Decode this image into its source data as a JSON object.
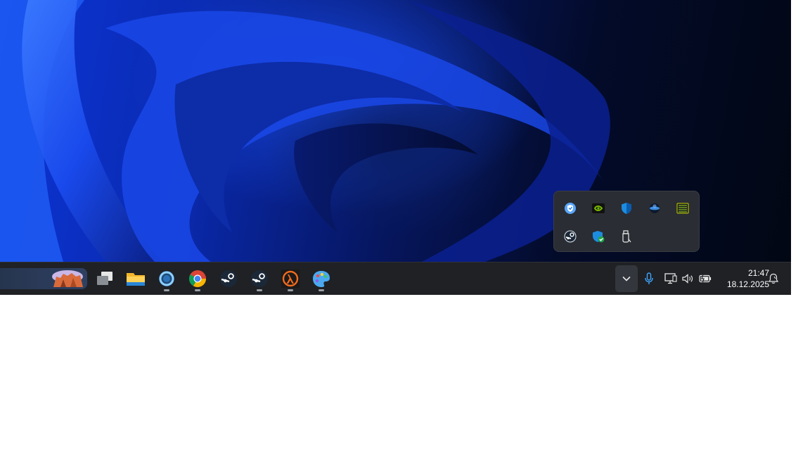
{
  "desktop": {
    "wallpaper": "windows-11-bloom-blue"
  },
  "tray_overflow": {
    "icons": [
      {
        "name": "vpn-shield-icon"
      },
      {
        "name": "nvidia-icon"
      },
      {
        "name": "defender-shield-icon"
      },
      {
        "name": "steelseries-orb-icon"
      },
      {
        "name": "hardware-monitor-icon"
      },
      {
        "name": "steam-icon"
      },
      {
        "name": "security-check-icon"
      },
      {
        "name": "usb-drive-icon"
      }
    ]
  },
  "taskbar": {
    "apps": [
      {
        "name": "task-view-icon",
        "running": false
      },
      {
        "name": "file-explorer-icon",
        "running": false
      },
      {
        "name": "app-ring-icon",
        "running": true
      },
      {
        "name": "chrome-icon",
        "running": true
      },
      {
        "name": "steam-icon",
        "running": false
      },
      {
        "name": "steam-icon",
        "running": true
      },
      {
        "name": "half-life-icon",
        "running": true
      },
      {
        "name": "paint-icon",
        "running": true
      }
    ],
    "system_tray": {
      "chevron": "chevron-up-icon",
      "mic": "microphone-icon",
      "network": "network-icon",
      "volume": "volume-icon",
      "battery": "battery-icon",
      "notifications": "notification-bell-icon"
    },
    "clock": {
      "time": "21:47",
      "date": "18.12.2025"
    }
  },
  "colors": {
    "taskbar_bg": "#1f2125",
    "flyout_bg": "#2a2d33",
    "accent": "#0a2ab0"
  }
}
